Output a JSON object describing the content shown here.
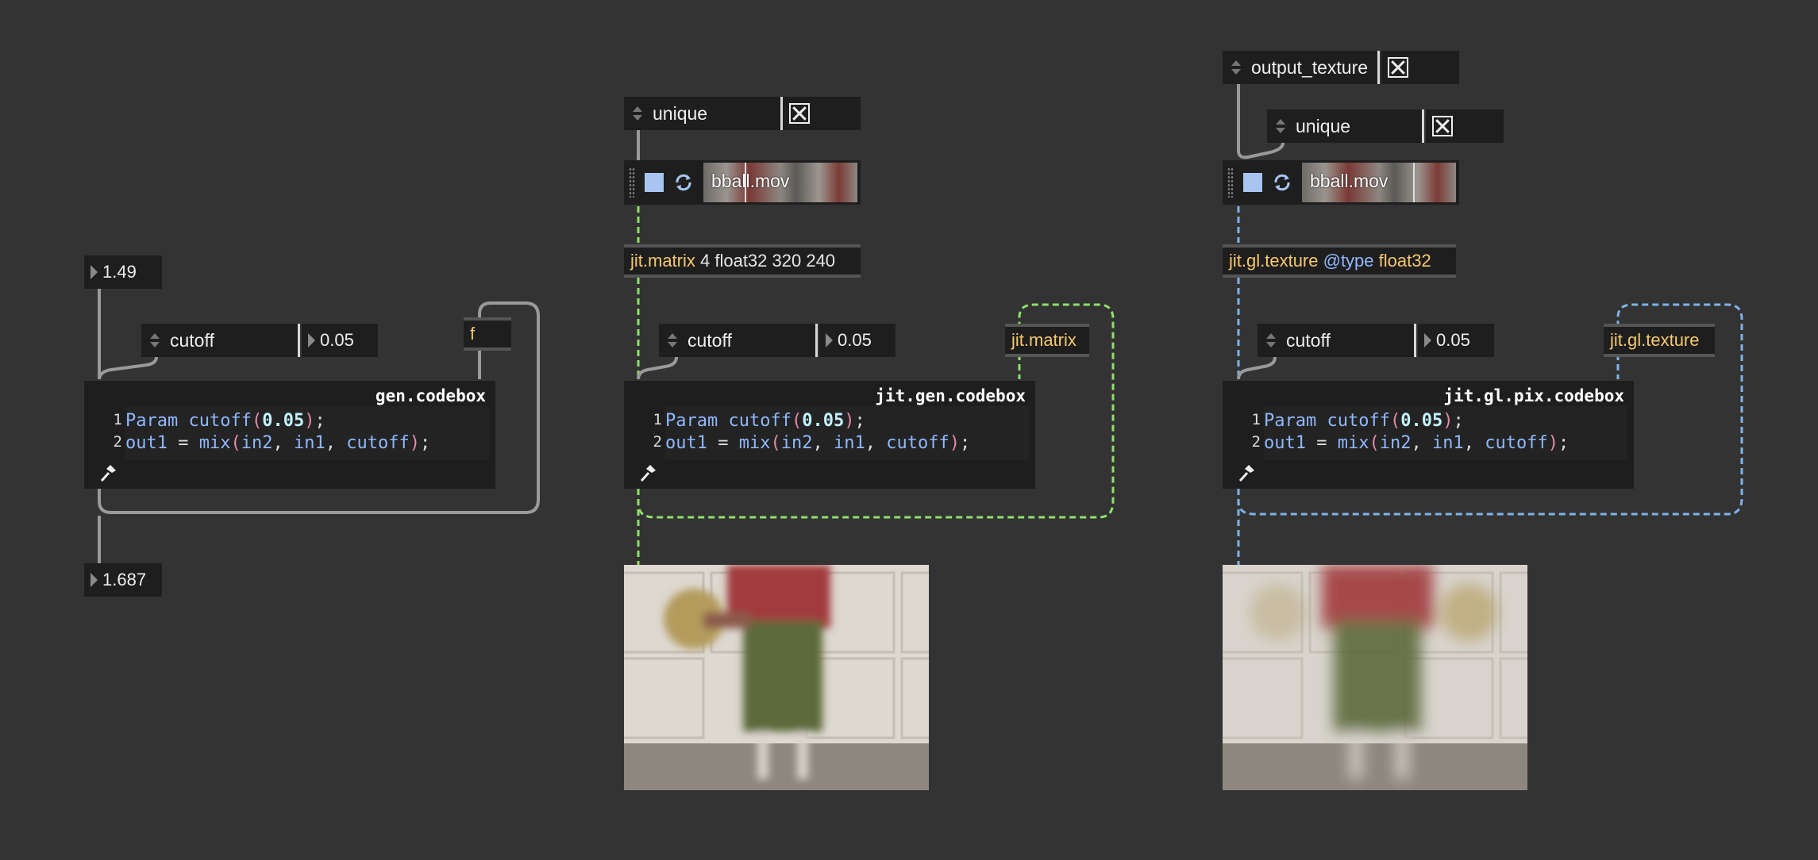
{
  "colors": {
    "background": "#333333",
    "object_bg": "#1e1e1e",
    "keyword": "#f7c86d",
    "attribute": "#8fb8ff",
    "matrix_cord": "#8ee06a",
    "texture_cord": "#7fb3e8",
    "control_cord": "#9a9a9a"
  },
  "patch1": {
    "input_number": "1.49",
    "output_number": "1.687",
    "param_menu": "cutoff",
    "param_value": "0.05",
    "feedback_object": "f",
    "codebox": {
      "title": "gen.codebox",
      "line_numbers": [
        "1",
        "2"
      ],
      "lines": [
        "Param cutoff(0.05);",
        "out1 = mix(in2, in1, cutoff);"
      ]
    }
  },
  "patch2": {
    "unique_menu": "unique",
    "player_file": "bball.mov",
    "matrix_object": {
      "keyword": "jit.matrix",
      "args": " 4 float32 320 240"
    },
    "param_menu": "cutoff",
    "param_value": "0.05",
    "feedback_object": "jit.matrix",
    "codebox": {
      "title": "jit.gen.codebox",
      "line_numbers": [
        "1",
        "2"
      ],
      "lines": [
        "Param cutoff(0.05);",
        "out1 = mix(in2, in1, cutoff);"
      ]
    }
  },
  "patch3": {
    "output_texture_menu": "output_texture",
    "unique_menu": "unique",
    "player_file": "bball.mov",
    "texture_object": {
      "keyword": "jit.gl.texture",
      "attr": " @type",
      "args": " float32"
    },
    "param_menu": "cutoff",
    "param_value": "0.05",
    "feedback_object": "jit.gl.texture",
    "codebox": {
      "title": "jit.gl.pix.codebox",
      "line_numbers": [
        "1",
        "2"
      ],
      "lines": [
        "Param cutoff(0.05);",
        "out1 = mix(in2, in1, cutoff);"
      ]
    }
  },
  "icons": [
    "toggle-x-icon",
    "stop-square-icon",
    "loop-icon",
    "hammer-icon",
    "grip-icon",
    "triangle-icon"
  ]
}
